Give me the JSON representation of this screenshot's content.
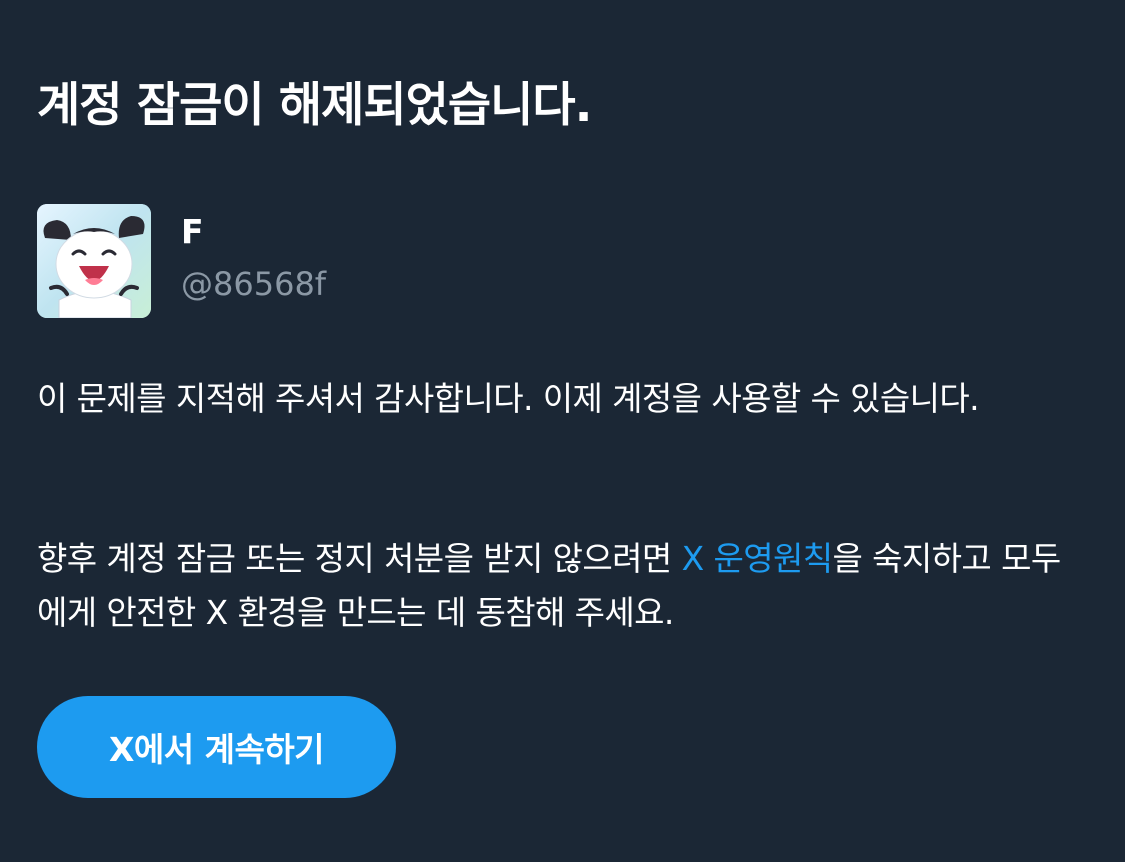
{
  "header": {
    "title": "계정 잠금이 해제되었습니다."
  },
  "account": {
    "display_name": "F",
    "handle": "@86568f",
    "avatar_icon": "cartoon-character-avatar"
  },
  "body": {
    "paragraph1": "이 문제를 지적해 주셔서 감사합니다. 이제 계정을 사용할 수 있습니다.",
    "paragraph2_before": "향후 계정 잠금 또는 정지 처분을 받지 않으려면 ",
    "paragraph2_link": "X 운영원칙",
    "paragraph2_after": "을 숙지하고 모두에게 안전한 X 환경을 만드는 데 동참해 주세요."
  },
  "actions": {
    "continue_label": "X에서 계속하기"
  },
  "colors": {
    "background": "#1b2735",
    "accent": "#1d9bf0",
    "muted_text": "#8b98a5"
  }
}
